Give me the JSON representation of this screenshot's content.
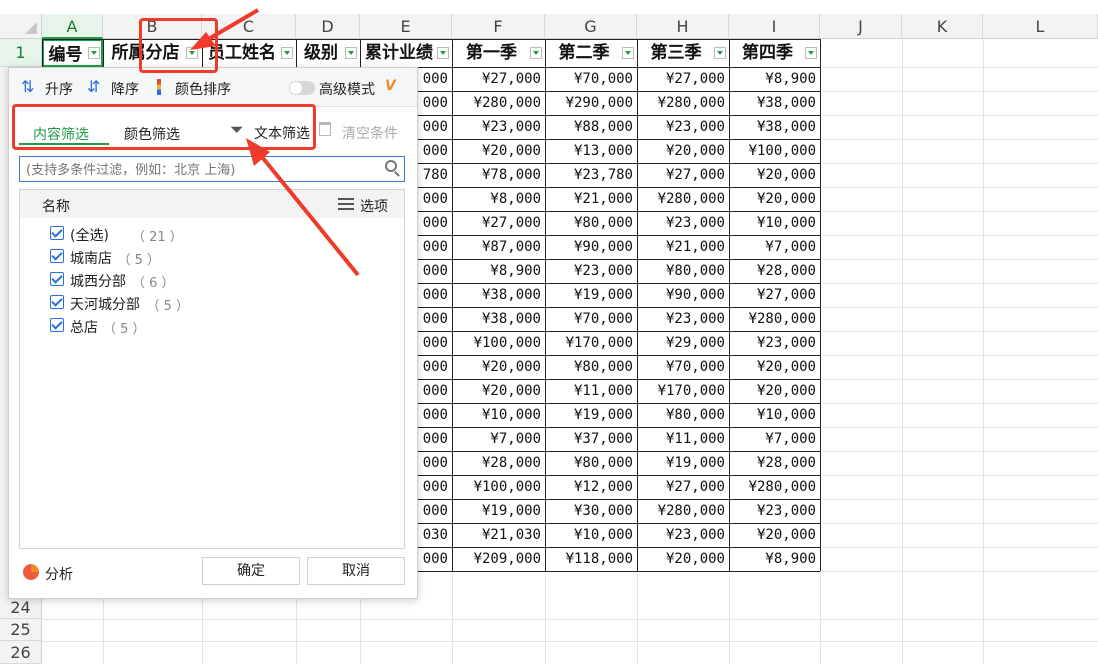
{
  "columns": [
    "A",
    "B",
    "C",
    "D",
    "E",
    "F",
    "G",
    "H",
    "I",
    "J",
    "K",
    "L"
  ],
  "row_numbers": [
    "1",
    "24",
    "25",
    "26"
  ],
  "headers": {
    "A": "编号",
    "B": "所属分店",
    "C": "员工姓名",
    "D": "级别",
    "E": "累计业绩",
    "F": "第一季",
    "G": "第二季",
    "H": "第三季",
    "I": "第四季"
  },
  "e_tail": [
    "000",
    "000",
    "000",
    "000",
    "780",
    "000",
    "000",
    "000",
    "000",
    "000",
    "000",
    "000",
    "000",
    "000",
    "000",
    "000",
    "000",
    "000",
    "000",
    "030",
    "000"
  ],
  "rows": [
    [
      "¥27,000",
      "¥70,000",
      "¥27,000",
      "¥8,900"
    ],
    [
      "¥280,000",
      "¥290,000",
      "¥280,000",
      "¥38,000"
    ],
    [
      "¥23,000",
      "¥88,000",
      "¥23,000",
      "¥38,000"
    ],
    [
      "¥20,000",
      "¥13,000",
      "¥20,000",
      "¥100,000"
    ],
    [
      "¥78,000",
      "¥23,780",
      "¥27,000",
      "¥20,000"
    ],
    [
      "¥8,000",
      "¥21,000",
      "¥280,000",
      "¥20,000"
    ],
    [
      "¥27,000",
      "¥80,000",
      "¥23,000",
      "¥10,000"
    ],
    [
      "¥87,000",
      "¥90,000",
      "¥21,000",
      "¥7,000"
    ],
    [
      "¥8,900",
      "¥23,000",
      "¥80,000",
      "¥28,000"
    ],
    [
      "¥38,000",
      "¥19,000",
      "¥90,000",
      "¥27,000"
    ],
    [
      "¥38,000",
      "¥70,000",
      "¥23,000",
      "¥280,000"
    ],
    [
      "¥100,000",
      "¥170,000",
      "¥29,000",
      "¥23,000"
    ],
    [
      "¥20,000",
      "¥80,000",
      "¥70,000",
      "¥20,000"
    ],
    [
      "¥20,000",
      "¥11,000",
      "¥170,000",
      "¥20,000"
    ],
    [
      "¥10,000",
      "¥19,000",
      "¥80,000",
      "¥10,000"
    ],
    [
      "¥7,000",
      "¥37,000",
      "¥11,000",
      "¥7,000"
    ],
    [
      "¥28,000",
      "¥80,000",
      "¥19,000",
      "¥28,000"
    ],
    [
      "¥100,000",
      "¥12,000",
      "¥27,000",
      "¥280,000"
    ],
    [
      "¥19,000",
      "¥30,000",
      "¥280,000",
      "¥23,000"
    ],
    [
      "¥21,030",
      "¥10,000",
      "¥23,000",
      "¥20,000"
    ],
    [
      "¥209,000",
      "¥118,000",
      "¥20,000",
      "¥8,900"
    ]
  ],
  "filter_panel": {
    "sort_asc": "升序",
    "sort_desc": "降序",
    "color_sort": "颜色排序",
    "advanced_mode": "高级模式",
    "tab_content": "内容筛选",
    "tab_color": "颜色筛选",
    "text_filter": "文本筛选",
    "clear_conditions": "清空条件",
    "search_placeholder": "(支持多条件过滤，例如：北京 上海)",
    "list_header": "名称",
    "options_label": "选项",
    "items": [
      {
        "label": "(全选)",
        "count": "（ 21 ）"
      },
      {
        "label": "城南店",
        "count": "（ 5 ）"
      },
      {
        "label": "城西分部",
        "count": "（ 6 ）"
      },
      {
        "label": "天河城分部",
        "count": "（ 5 ）"
      },
      {
        "label": "总店",
        "count": "（ 5 ）"
      }
    ],
    "analyze": "分析",
    "ok": "确定",
    "cancel": "取消"
  },
  "colors": {
    "accent_green": "#1e9b4a",
    "annotation_red": "#f03a2a",
    "checkbox_blue": "#2a6fdb"
  }
}
